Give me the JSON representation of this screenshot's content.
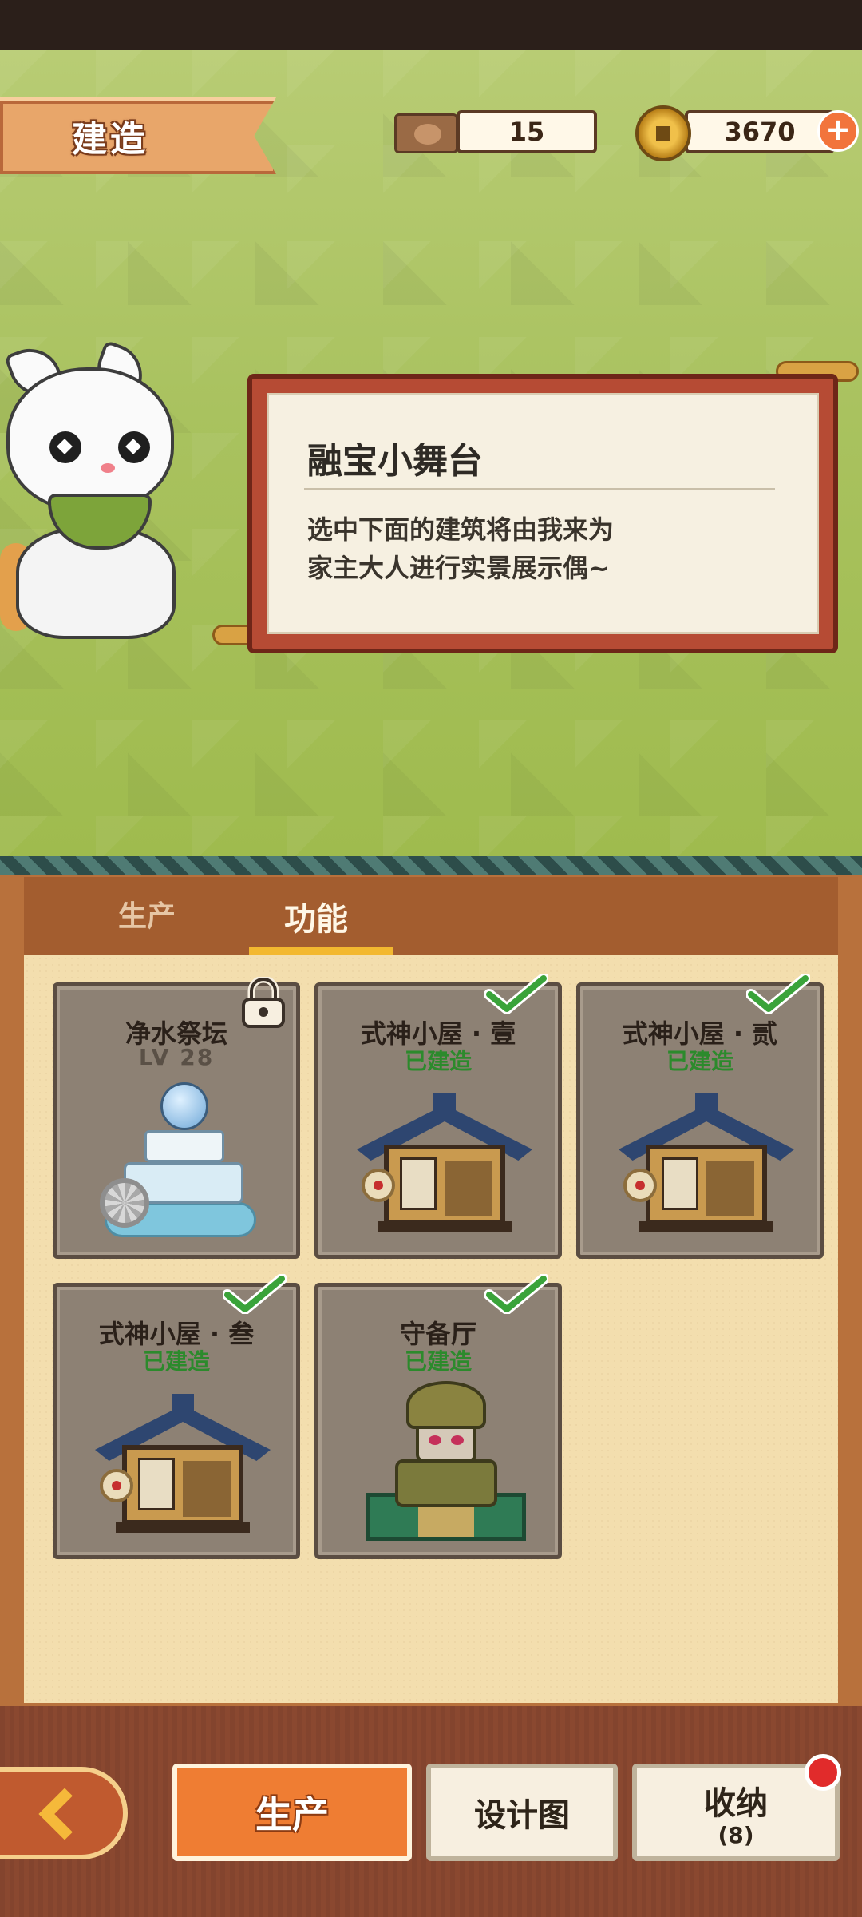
{
  "header": {
    "title": "建造",
    "wood_amount": "15",
    "coin_amount": "3670",
    "add_symbol": "+"
  },
  "dialog": {
    "title": "融宝小舞台",
    "text": "选中下面的建筑将由我来为\n家主大人进行实景展示偶~"
  },
  "tabs": [
    {
      "label": "生产",
      "active": false
    },
    {
      "label": "功能",
      "active": true
    }
  ],
  "buildings": [
    {
      "name": "净水祭坛",
      "level": "LV 28",
      "locked": true,
      "icon": "fountain-icon"
    },
    {
      "name": "式神小屋 · 壹",
      "status": "已建造",
      "built": true,
      "icon": "shikigami-house-icon"
    },
    {
      "name": "式神小屋 · 贰",
      "status": "已建造",
      "built": true,
      "icon": "shikigami-house-icon"
    },
    {
      "name": "式神小屋 · 叁",
      "status": "已建造",
      "built": true,
      "icon": "shikigami-house-icon"
    },
    {
      "name": "守备厅",
      "status": "已建造",
      "built": true,
      "icon": "guard-hall-icon"
    }
  ],
  "bottom_bar": {
    "produce_label": "生产",
    "design_label": "设计图",
    "storage_label": "收纳",
    "storage_count": "(8)"
  },
  "colors": {
    "accent_orange": "#ef7d33",
    "built_green": "#2c8a2c",
    "board_red": "#b64b34"
  }
}
